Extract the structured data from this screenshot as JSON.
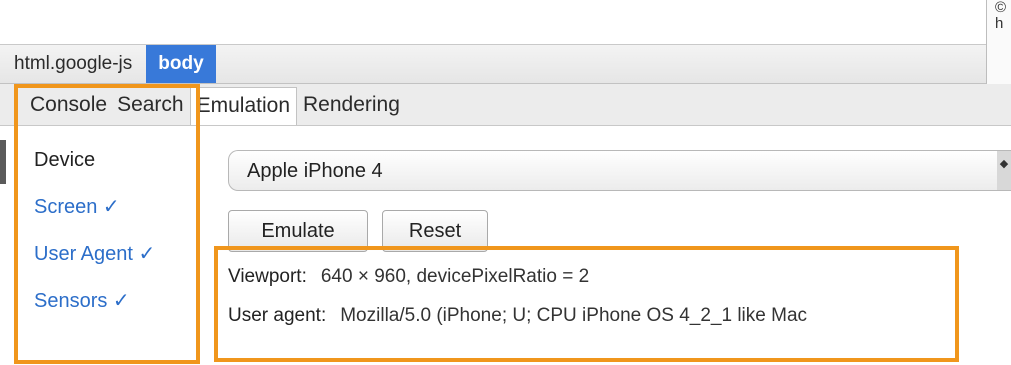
{
  "top_right": {
    "line1": "©",
    "line2": "h"
  },
  "breadcrumb": [
    {
      "label": "html.google-js",
      "selected": false
    },
    {
      "label": "body",
      "selected": true
    }
  ],
  "tabs": [
    {
      "label": "Console",
      "active": false
    },
    {
      "label": "Search",
      "active": false
    },
    {
      "label": "Emulation",
      "active": true
    },
    {
      "label": "Rendering",
      "active": false
    }
  ],
  "sidebar": {
    "items": [
      {
        "label": "Device",
        "current": true
      },
      {
        "label": "Screen ✓",
        "current": false
      },
      {
        "label": "User Agent ✓",
        "current": false
      },
      {
        "label": "Sensors ✓",
        "current": false
      }
    ]
  },
  "device": {
    "selected": "Apple iPhone 4",
    "arrows": "◆"
  },
  "buttons": {
    "emulate": "Emulate",
    "reset": "Reset"
  },
  "info": {
    "viewport_label": "Viewport:",
    "viewport_value": "640 × 960, devicePixelRatio = 2",
    "ua_label": "User agent:",
    "ua_value": "Mozilla/5.0 (iPhone; U; CPU iPhone OS 4_2_1 like Mac"
  },
  "colors": {
    "accent": "#3879d9",
    "link": "#2c6ec9",
    "highlight": "#f0961c"
  }
}
